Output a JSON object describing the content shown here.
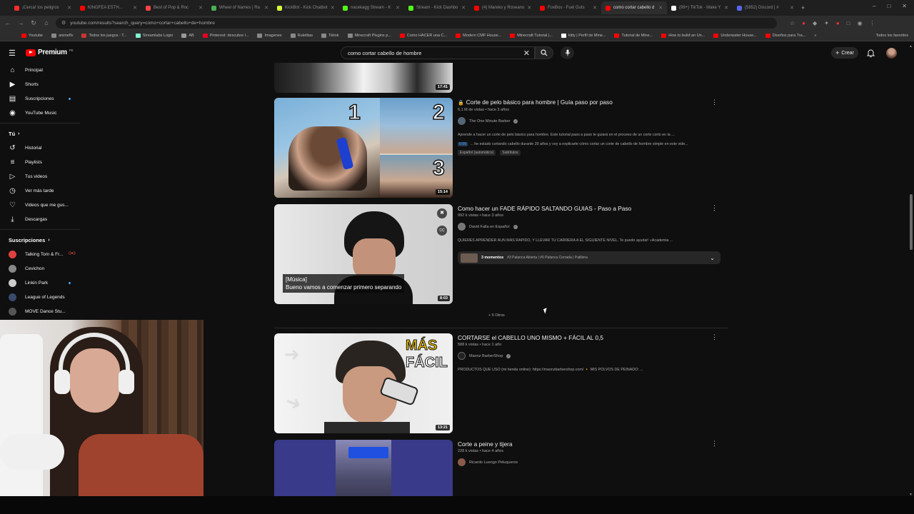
{
  "browser": {
    "tabs": [
      {
        "label": "¡Cerca! los peligros",
        "color": "#ff2d2d"
      },
      {
        "label": "KINGFEA ESTH...",
        "color": "#ff0000"
      },
      {
        "label": "Best of Pop & Roc",
        "color": "#ff4444"
      },
      {
        "label": "Wheel of Names | Ra",
        "color": "#4caf50"
      },
      {
        "label": "KickBot - Kick Chatbot",
        "color": "#d4ff3a"
      },
      {
        "label": "nacekagg Stream - K",
        "color": "#53fc18"
      },
      {
        "label": "Stream - Kick Dashbo",
        "color": "#53fc18"
      },
      {
        "label": "(4) Mareko y Roseano",
        "color": "#ff0000"
      },
      {
        "label": "FoxBox - Fuel Guts",
        "color": "#ff0000"
      },
      {
        "label": "como cortar cabello d",
        "color": "#ff0000",
        "active": true
      },
      {
        "label": "(99+) TikTok - Make Y",
        "color": "#ffffff"
      },
      {
        "label": "(5852) Discord | #",
        "color": "#5865f2"
      }
    ],
    "url": "youtube.com/results?search_query=como+cortar+cabello+de+hombre",
    "bookmarks": [
      {
        "label": "Youtube",
        "color": "#ff0000"
      },
      {
        "label": "animeflv",
        "color": "#888888"
      },
      {
        "label": "Todos los juegos - T...",
        "color": "#c33"
      },
      {
        "label": "Streamlabs Login",
        "color": "#80f5d2"
      },
      {
        "label": "AB",
        "color": "#999999"
      },
      {
        "label": "Pinterest: descubre l...",
        "color": "#e60023"
      },
      {
        "label": "Imagenes",
        "color": "#888888"
      },
      {
        "label": "Ruletitas",
        "color": "#888888"
      },
      {
        "label": "Tiktok",
        "color": "#888888"
      },
      {
        "label": "Minecraft Plugins p...",
        "color": "#888888"
      },
      {
        "label": "Como HACER una C...",
        "color": "#ff0000"
      },
      {
        "label": "Modern CMF House...",
        "color": "#ff0000"
      },
      {
        "label": "Minecraft Tutorial |...",
        "color": "#ff0000"
      },
      {
        "label": "kitty | Perfil de Mine...",
        "color": "#ffffff"
      },
      {
        "label": "Tutorial de Mine...",
        "color": "#ff0000"
      },
      {
        "label": "How to build an Un...",
        "color": "#ff0000"
      },
      {
        "label": "Underwater House...",
        "color": "#ff0000"
      },
      {
        "label": "Diseños para Tra...",
        "color": "#ff0000"
      }
    ],
    "bookmarks_all": "Todos los favoritos"
  },
  "header": {
    "logo_text": "Premium",
    "logo_country": "PE",
    "search_value": "como cortar cabello de hombre",
    "create_label": "Crear"
  },
  "sidebar": {
    "main": [
      {
        "label": "Principal",
        "icon": "home-icon"
      },
      {
        "label": "Shorts",
        "icon": "shorts-icon"
      },
      {
        "label": "Suscripciones",
        "icon": "subscriptions-icon"
      },
      {
        "label": "YouTube Music",
        "icon": "music-icon"
      }
    ],
    "you_header": "Tú",
    "you": [
      {
        "label": "Historial",
        "icon": "history-icon"
      },
      {
        "label": "Playlists",
        "icon": "playlists-icon"
      },
      {
        "label": "Tus videos",
        "icon": "your-videos-icon"
      },
      {
        "label": "Ver más tarde",
        "icon": "watch-later-icon"
      },
      {
        "label": "Videos que me gus...",
        "icon": "liked-icon"
      },
      {
        "label": "Descargas",
        "icon": "downloads-icon"
      }
    ],
    "subs_header": "Suscripciones",
    "subs": [
      {
        "label": "Talking Tom & Fr...",
        "color": "#e04040",
        "live": true
      },
      {
        "label": "Cevichon",
        "color": "#888888"
      },
      {
        "label": "Linkin Park",
        "color": "#cccccc"
      },
      {
        "label": "League of Legends",
        "color": "#3a4a6a"
      },
      {
        "label": "MOVE Dance Stu...",
        "color": "#555555"
      }
    ]
  },
  "results": [
    {
      "duration": "17:41",
      "partial": true
    },
    {
      "title": "Corte de pelo básico para hombre | Guía paso por paso",
      "prefix": "🔒",
      "meta": "6,1 M de vistas • hace 3 años",
      "channel": "The One Minute Barber",
      "desc1": "Aprende a hacer un corte de pelo básico para hombre. Este tutorial paso a paso te guiará en el proceso de un corte corto en la ...",
      "desc2_stamp": "0:00",
      "desc2": "... he estado cortando cabello durante 20 años y voy a explicarte cómo cortar un corte de cabello de hombre simple en este vide...",
      "tags": [
        "Español (automático)",
        "Subtítulos"
      ],
      "duration": "15:14"
    },
    {
      "title": "Como hacer un FADE RÁPIDO SALTANDO GUIAS - Paso a Paso",
      "meta": "992 k vistas • hace 3 años",
      "channel": "David Falla en Español",
      "desc1": "QUIERES APRENDER AUN MAS RAPIDO, Y LLEVAR TU CARRERA A EL SIGUIENTE NIVEL. Te puedo ayudar! «Academia ...",
      "moments_count": "3 momentos",
      "moments_text": "#3 Palanca Abierta | #0 Palanca Cerrada | Patillera",
      "caption_line1": "[Música]",
      "caption_line2": "Bueno vamos a comenzar primero separando",
      "duration": "8:03"
    },
    {
      "title": "CORTARSE el CABELLO UNO MISMO + FÁCIL AL 0,5",
      "meta": "588 k vistas • hace 1 año",
      "channel": "Maonz BarberShop",
      "desc1": "PRODUCTOS QUE USO (mi tienda online): https://maonzbarbershop.com/ 🔸 MIS POLVOS DE PEINADO: ...",
      "thumb_text1": "MÁS",
      "thumb_text2": "FÁCIL",
      "duration": "13:21"
    },
    {
      "title": "Corte a peine y tijera",
      "meta": "228 k vistas • hace 4 años",
      "channel": "Ricardo Luengo Peluqueros"
    }
  ],
  "others_label": "+ 6 Otros"
}
